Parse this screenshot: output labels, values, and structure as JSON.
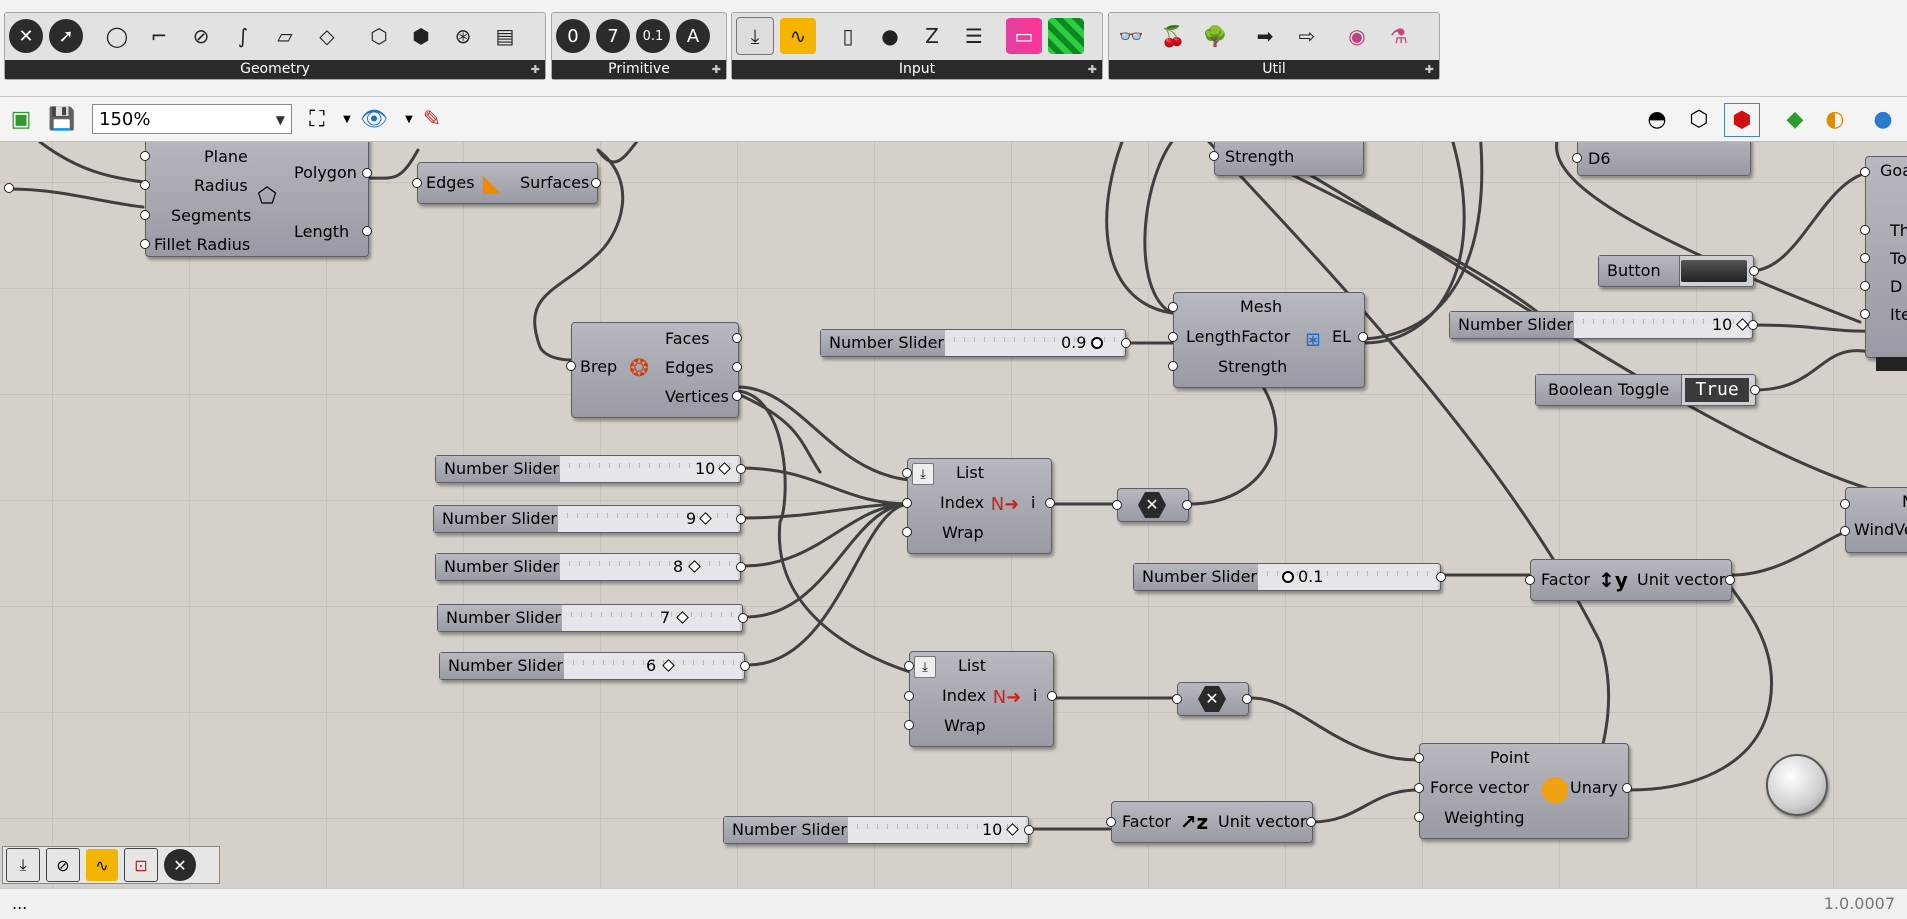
{
  "ribbon": {
    "groups": [
      {
        "label": "Geometry",
        "icons": [
          "close-icon",
          "arrow-icon",
          "circle-icon",
          "polyline-icon",
          "ellipse-icon",
          "curve-icon",
          "rectangle-icon",
          "polygon-icon",
          "box-icon",
          "sphere-icon",
          "mesh-icon",
          "surface-icon"
        ]
      },
      {
        "label": "Primitive",
        "icons": [
          "zero-icon",
          "integer-icon",
          "number-icon",
          "text-icon"
        ]
      },
      {
        "label": "Input",
        "icons": [
          "download-icon",
          "graph-icon",
          "toggle-icon",
          "circle-button-icon",
          "slider-icon",
          "list-icon",
          "gradient-icon",
          "color-swatch-icon"
        ]
      },
      {
        "label": "Util",
        "icons": [
          "glasses-icon",
          "cherry-icon",
          "tree-icon",
          "arrow-right-icon",
          "arrow-outline-icon",
          "particle-icon",
          "flask-icon"
        ]
      }
    ],
    "primitive_glyphs": [
      "0",
      "7",
      "0.1",
      "A"
    ]
  },
  "toolbar": {
    "zoom": "150%"
  },
  "canvas": {
    "polygon_node": {
      "inputs": [
        "Plane",
        "Radius",
        "Segments",
        "Fillet Radius"
      ],
      "outputs": [
        "Polygon",
        "Length"
      ]
    },
    "boundary_node": {
      "input": "Edges",
      "output": "Surfaces"
    },
    "deconstruct_node": {
      "input": "Brep",
      "outputs": [
        "Faces",
        "Edges",
        "Vertices"
      ]
    },
    "strength_top": "Strength",
    "d6_label": "D6",
    "goal_partial": [
      "Goal",
      "Th",
      "To",
      "D",
      "Ite"
    ],
    "windvec_partial": [
      "M",
      "WindVe"
    ],
    "length_node": {
      "inputs": [
        "Mesh",
        "LengthFactor",
        "Strength"
      ],
      "output": "EL"
    },
    "button": {
      "label": "Button"
    },
    "slider_top_right": {
      "label": "Number Slider",
      "value": "10"
    },
    "boolean_toggle": {
      "label": "Boolean Toggle",
      "value": "True"
    },
    "slider_09": {
      "label": "Number Slider",
      "value": "0.9"
    },
    "sliders_left": [
      {
        "label": "Number Slider",
        "value": "10"
      },
      {
        "label": "Number Slider",
        "value": "9"
      },
      {
        "label": "Number Slider",
        "value": "8"
      },
      {
        "label": "Number Slider",
        "value": "7"
      },
      {
        "label": "Number Slider",
        "value": "6"
      }
    ],
    "list_item_1": {
      "inputs": [
        "List",
        "Index",
        "Wrap"
      ],
      "output": "i"
    },
    "list_item_2": {
      "inputs": [
        "List",
        "Index",
        "Wrap"
      ],
      "output": "i"
    },
    "slider_01": {
      "label": "Number Slider",
      "value": "0.1"
    },
    "unit_y": {
      "input": "Factor",
      "output": "Unit vector"
    },
    "unit_z": {
      "input": "Factor",
      "output": "Unit vector"
    },
    "slider_bottom": {
      "label": "Number Slider",
      "value": "10"
    },
    "unary_node": {
      "inputs": [
        "Point",
        "Force vector",
        "Weighting"
      ],
      "output": "Unary"
    }
  },
  "status": {
    "left": "...",
    "version": "1.0.0007"
  }
}
